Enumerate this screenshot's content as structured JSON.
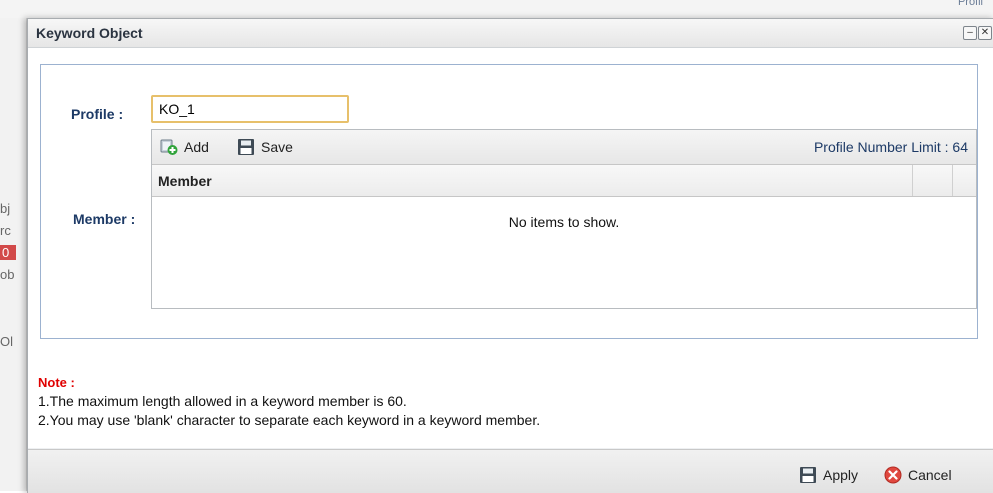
{
  "background": {
    "top_right_fragment": "Profil",
    "left_fragments": [
      "bj",
      "rc",
      "0",
      "ob",
      "Ol"
    ]
  },
  "dialog": {
    "title": "Keyword Object"
  },
  "form": {
    "profile_label": "Profile :",
    "profile_value": "KO_1",
    "member_label": "Member :"
  },
  "grid": {
    "add_label": "Add",
    "save_label": "Save",
    "limit_text": "Profile Number Limit : 64",
    "column_member": "Member",
    "empty_text": "No items to show."
  },
  "note": {
    "title": "Note :",
    "lines": [
      "1.The maximum length allowed in a keyword member is 60.",
      "2.You may use 'blank' character to separate each keyword in a keyword member."
    ]
  },
  "footer": {
    "apply_label": "Apply",
    "cancel_label": "Cancel"
  }
}
